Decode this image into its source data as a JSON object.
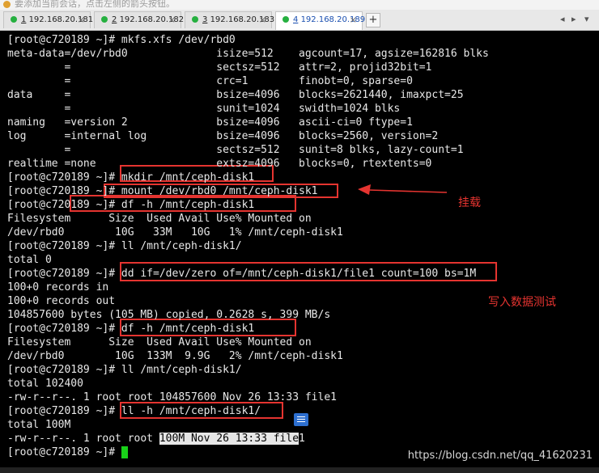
{
  "top_hint": "要添加当前会话，点击左侧的箭头按钮。",
  "tabs": [
    {
      "num": "1",
      "label": "192.168.20.181"
    },
    {
      "num": "2",
      "label": "192.168.20.182"
    },
    {
      "num": "3",
      "label": "192.168.20.183"
    },
    {
      "num": "4",
      "label": "192.168.20.189"
    }
  ],
  "active_tab_index": 3,
  "new_tab_label": "+",
  "window_controls": [
    "◂",
    "▸",
    "▾"
  ],
  "terminal_lines": [
    "[root@c720189 ~]# mkfs.xfs /dev/rbd0",
    "meta-data=/dev/rbd0              isize=512    agcount=17, agsize=162816 blks",
    "         =                       sectsz=512   attr=2, projid32bit=1",
    "         =                       crc=1        finobt=0, sparse=0",
    "data     =                       bsize=4096   blocks=2621440, imaxpct=25",
    "         =                       sunit=1024   swidth=1024 blks",
    "naming   =version 2              bsize=4096   ascii-ci=0 ftype=1",
    "log      =internal log           bsize=4096   blocks=2560, version=2",
    "         =                       sectsz=512   sunit=8 blks, lazy-count=1",
    "realtime =none                   extsz=4096   blocks=0, rtextents=0",
    "[root@c720189 ~]# mkdir /mnt/ceph-disk1",
    "[root@c720189 ~]# mount /dev/rbd0 /mnt/ceph-disk1",
    "[root@c720189 ~]# df -h /mnt/ceph-disk1",
    "Filesystem      Size  Used Avail Use% Mounted on",
    "/dev/rbd0        10G   33M   10G   1% /mnt/ceph-disk1",
    "[root@c720189 ~]# ll /mnt/ceph-disk1/",
    "total 0",
    "[root@c720189 ~]# dd if=/dev/zero of=/mnt/ceph-disk1/file1 count=100 bs=1M",
    "100+0 records in",
    "100+0 records out",
    "104857600 bytes (105 MB) copied, 0.2628 s, 399 MB/s",
    "[root@c720189 ~]# df -h /mnt/ceph-disk1",
    "Filesystem      Size  Used Avail Use% Mounted on",
    "/dev/rbd0        10G  133M  9.9G   2% /mnt/ceph-disk1",
    "[root@c720189 ~]# ll /mnt/ceph-disk1/",
    "total 102400",
    "-rw-r--r--. 1 root root 104857600 Nov 26 13:33 file1",
    "[root@c720189 ~]# ll -h /mnt/ceph-disk1/",
    "total 100M",
    {
      "pre": "-rw-r--r--. 1 root root ",
      "selected": "100M Nov 26 13:33 file",
      "post": "1"
    },
    "[root@c720189 ~]# "
  ],
  "annotations": {
    "mount_label": "挂载",
    "write_test_label": "写入数据测试"
  },
  "watermark": "https://blog.csdn.net/qq_41620231",
  "colors": {
    "terminal_bg": "#000000",
    "terminal_fg": "#e8e8e8",
    "cursor": "#19d219",
    "annotation_red": "#e53430"
  }
}
